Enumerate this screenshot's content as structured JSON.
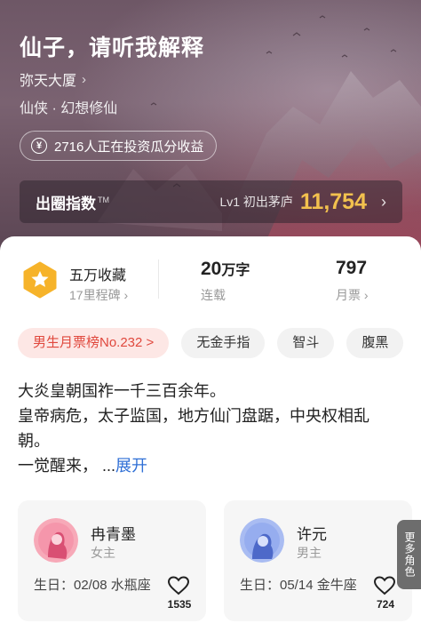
{
  "book": {
    "title": "仙子，请听我解释",
    "author": "弥天大厦",
    "genre": "仙侠 · 幻想修仙",
    "investors": "2716人正在投资瓜分收益"
  },
  "index": {
    "label": "出圈指数",
    "trademark": "TM",
    "level": "Lv1 初出茅庐",
    "value": "11,754"
  },
  "stats": {
    "favorites": "五万收藏",
    "milestone": "17里程碑",
    "words_num": "20",
    "words_unit": "万字",
    "status": "连载",
    "monthly_tickets": "797",
    "monthly_label": "月票"
  },
  "tags": [
    "男生月票榜No.232 >",
    "无金手指",
    "智斗",
    "腹黑"
  ],
  "synopsis": {
    "line1": "大炎皇朝国祚一千三百余年。",
    "line2": "皇帝病危，太子监国，地方仙门盘踞，中央权相乱朝。",
    "line3": "一觉醒来，  ...",
    "expand": "展开"
  },
  "roles": [
    {
      "name": "冉青墨",
      "type": "女主",
      "birthday": "生日：02/08 水瓶座",
      "likes": "1535"
    },
    {
      "name": "许元",
      "type": "男主",
      "birthday": "生日：05/14 金牛座",
      "likes": "724"
    }
  ],
  "more_roles": "更多角色",
  "colors": {
    "accent_gold": "#f2c14e",
    "rank_red": "#e0483d",
    "link_blue": "#2f6fd6"
  }
}
